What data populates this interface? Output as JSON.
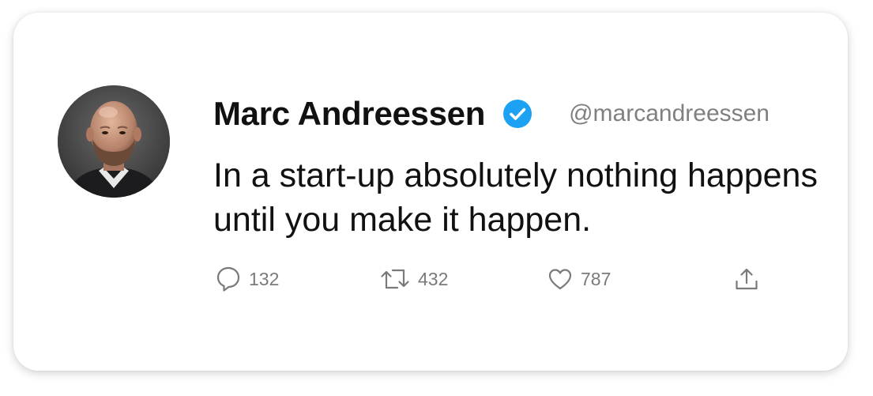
{
  "tweet": {
    "author": {
      "name": "Marc Andreessen",
      "handle": "@marcandreessen",
      "verified": true,
      "verified_color": "#1da1f2"
    },
    "text": "In a start-up absolutely nothing happens until you make it happen.",
    "actions": {
      "reply": {
        "icon": "reply-icon",
        "count": "132"
      },
      "retweet": {
        "icon": "retweet-icon",
        "count": "432"
      },
      "like": {
        "icon": "heart-icon",
        "count": "787"
      },
      "share": {
        "icon": "share-icon"
      }
    }
  },
  "colors": {
    "text_primary": "#111111",
    "text_secondary": "#808080",
    "card_background": "#ffffff"
  }
}
